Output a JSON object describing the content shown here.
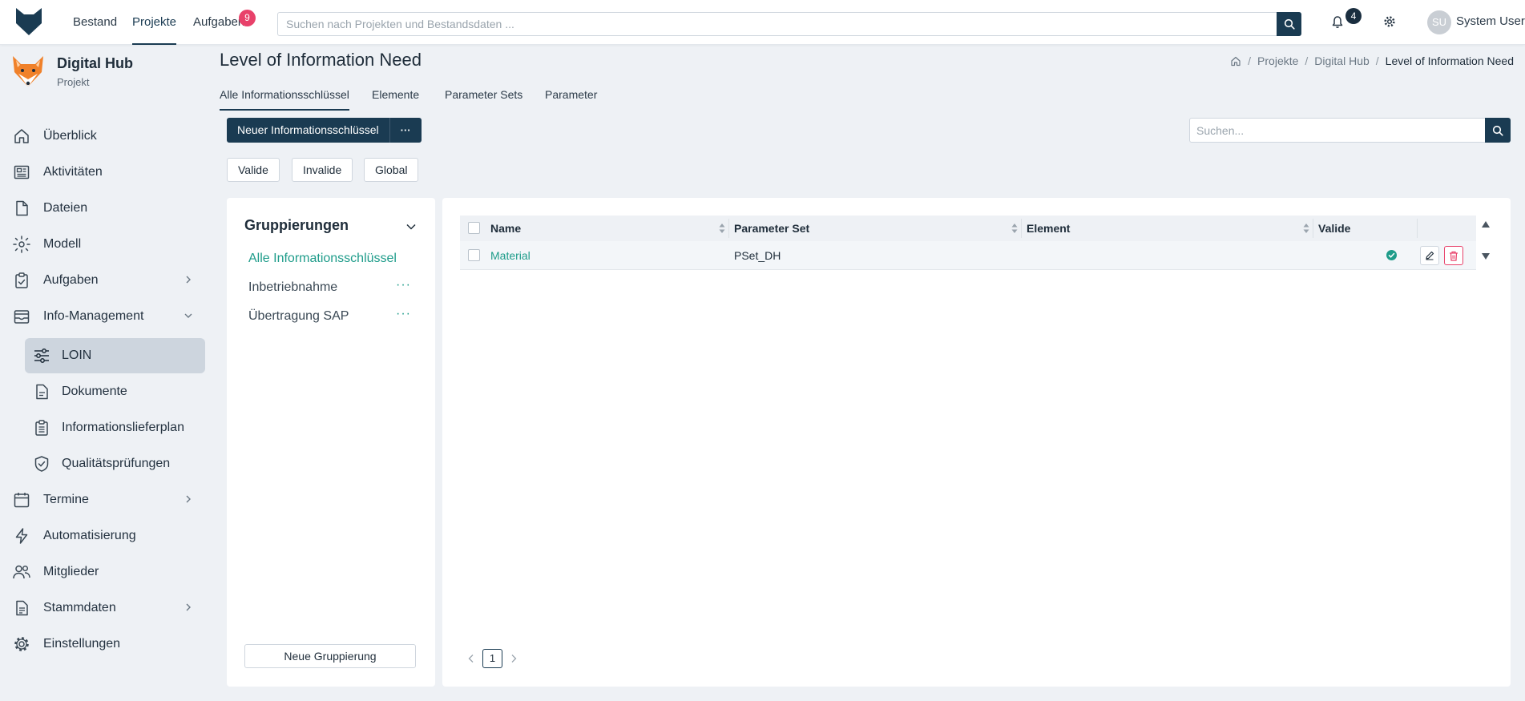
{
  "topbar": {
    "logo_icon": "fox-head-logo",
    "nav": [
      {
        "label": "Bestand"
      },
      {
        "label": "Projekte"
      },
      {
        "label": "Aufgaben",
        "badge": "9"
      }
    ],
    "search_placeholder": "Suchen nach Projekten und Bestandsdaten ...",
    "notification_count": "4",
    "user_initials": "SU",
    "user_name": "System User"
  },
  "project": {
    "name": "Digital Hub",
    "type": "Projekt"
  },
  "sidebar": {
    "items": [
      {
        "label": "Überblick",
        "icon": "home-icon"
      },
      {
        "label": "Aktivitäten",
        "icon": "newspaper-icon"
      },
      {
        "label": "Dateien",
        "icon": "file-icon"
      },
      {
        "label": "Modell",
        "icon": "model-cube-icon"
      },
      {
        "label": "Aufgaben",
        "icon": "clipboard-check-icon"
      },
      {
        "label": "Info-Management",
        "icon": "inbox-icon"
      },
      {
        "label": "Termine",
        "icon": "calendar-icon"
      },
      {
        "label": "Automatisierung",
        "icon": "lightning-icon"
      },
      {
        "label": "Mitglieder",
        "icon": "users-icon"
      },
      {
        "label": "Stammdaten",
        "icon": "document-list-icon"
      },
      {
        "label": "Einstellungen",
        "icon": "gear-icon"
      }
    ],
    "sub_items": [
      {
        "label": "LOIN",
        "icon": "sliders-icon"
      },
      {
        "label": "Dokumente",
        "icon": "document-icon"
      },
      {
        "label": "Informationslieferplan",
        "icon": "clipboard-list-icon"
      },
      {
        "label": "Qualitätsprüfungen",
        "icon": "shield-check-icon"
      }
    ]
  },
  "page": {
    "title": "Level of Information Need",
    "breadcrumb": [
      "Projekte",
      "Digital Hub",
      "Level of Information Need"
    ],
    "tabs": [
      "Alle Informationsschlüssel",
      "Elemente",
      "Parameter Sets",
      "Parameter"
    ],
    "new_button": "Neuer Informationsschlüssel",
    "more_button": "···",
    "filters": [
      "Valide",
      "Invalide",
      "Global"
    ],
    "search_placeholder": "Suchen..."
  },
  "groupings": {
    "title": "Gruppierungen",
    "items": [
      {
        "label": "Alle Informationsschlüssel"
      },
      {
        "label": "Inbetriebnahme",
        "dots": "···"
      },
      {
        "label": "Übertragung SAP",
        "dots": "···"
      }
    ],
    "new_button": "Neue Gruppierung"
  },
  "table": {
    "columns": [
      "Name",
      "Parameter Set",
      "Element",
      "Valide"
    ],
    "rows": [
      {
        "name": "Material",
        "parameter_set": "PSet_DH",
        "element": "",
        "valid": true
      }
    ],
    "page": "1"
  },
  "colors": {
    "primary": "#1a3b52",
    "accent": "#1e9c8a",
    "danger": "#e8416a",
    "background": "#eef1f5"
  }
}
